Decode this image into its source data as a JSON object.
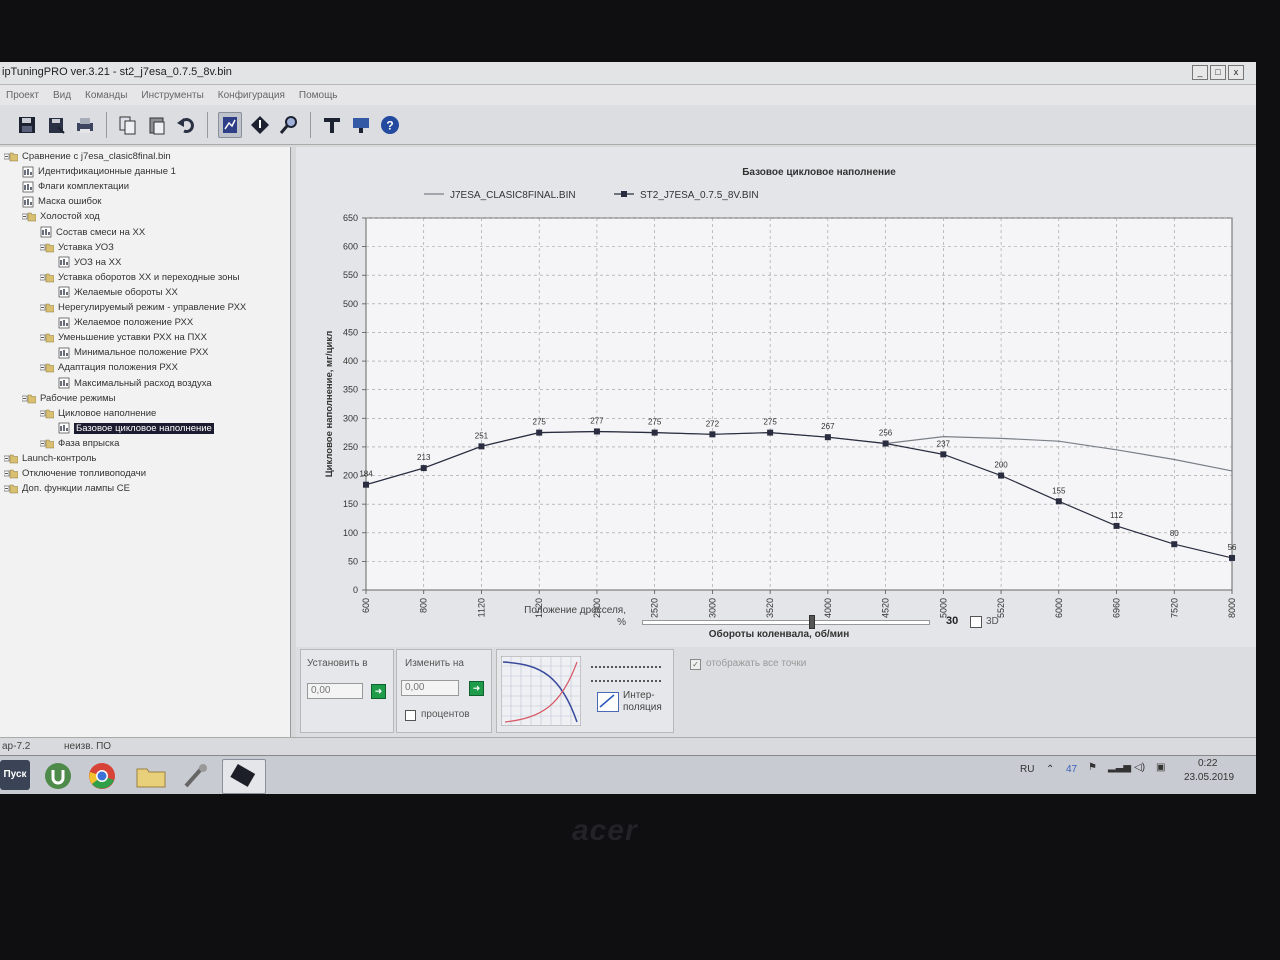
{
  "window": {
    "title": "ipTuningPRO ver.3.21 - st2_j7esa_0.7.5_8v.bin",
    "controls": [
      "_",
      "□",
      "x"
    ]
  },
  "menu": [
    "Проект",
    "Вид",
    "Команды",
    "Инструменты",
    "Конфигурация",
    "Помощь"
  ],
  "tree": [
    {
      "label": "Сравнение с j7esa_clasic8final.bin",
      "level": 0,
      "kind": "root"
    },
    {
      "label": "Идентификационные данные 1",
      "level": 1,
      "kind": "leaf"
    },
    {
      "label": "Флаги комплектации",
      "level": 1,
      "kind": "leaf"
    },
    {
      "label": "Маска ошибок",
      "level": 1,
      "kind": "leaf"
    },
    {
      "label": "Холостой ход",
      "level": 1,
      "kind": "folder"
    },
    {
      "label": "Состав смеси на ХХ",
      "level": 2,
      "kind": "leaf"
    },
    {
      "label": "Уставка УОЗ",
      "level": 2,
      "kind": "folder"
    },
    {
      "label": "УОЗ на ХХ",
      "level": 3,
      "kind": "leaf"
    },
    {
      "label": "Уставка оборотов ХХ и переходные зоны",
      "level": 2,
      "kind": "folder"
    },
    {
      "label": "Желаемые обороты ХХ",
      "level": 3,
      "kind": "leaf"
    },
    {
      "label": "Нерегулируемый режим - управление РХХ",
      "level": 2,
      "kind": "folder"
    },
    {
      "label": "Желаемое положение РХХ",
      "level": 3,
      "kind": "leaf"
    },
    {
      "label": "Уменьшение уставки РХХ на ПХХ",
      "level": 2,
      "kind": "folder"
    },
    {
      "label": "Минимальное положение РХХ",
      "level": 3,
      "kind": "leaf"
    },
    {
      "label": "Адаптация положения РХХ",
      "level": 2,
      "kind": "folder"
    },
    {
      "label": "Максимальный расход воздуха",
      "level": 3,
      "kind": "leaf"
    },
    {
      "label": "Рабочие режимы",
      "level": 1,
      "kind": "folder"
    },
    {
      "label": "Цикловое наполнение",
      "level": 2,
      "kind": "folder"
    },
    {
      "label": "Базовое цикловое наполнение",
      "level": 3,
      "kind": "leaf",
      "selected": true
    },
    {
      "label": "Фаза впрыска",
      "level": 2,
      "kind": "folder"
    },
    {
      "label": "Launch-контроль",
      "level": 0,
      "kind": "folder"
    },
    {
      "label": "Отключение топливоподачи",
      "level": 0,
      "kind": "folder"
    },
    {
      "label": "Доп. функции лампы CE",
      "level": 0,
      "kind": "folder"
    }
  ],
  "chart_data": {
    "type": "line",
    "title": "Базовое цикловое наполнение",
    "xlabel": "Обороты коленвала, об/мин",
    "ylabel": "Цикловое наполнение, мг/цикл",
    "categories": [
      "600",
      "800",
      "1120",
      "1520",
      "2000",
      "2520",
      "3000",
      "3520",
      "4000",
      "4520",
      "5000",
      "5520",
      "6000",
      "6960",
      "7520",
      "8000"
    ],
    "yticks": [
      0,
      50,
      100,
      150,
      200,
      250,
      300,
      350,
      400,
      450,
      500,
      550,
      600,
      650
    ],
    "ylim": [
      0,
      650
    ],
    "grid": true,
    "legend": "top-left",
    "series": [
      {
        "name": "J7ESA_CLASIC8FINAL.BIN",
        "values": [
          184,
          213,
          251,
          275,
          277,
          275,
          272,
          275,
          267,
          256,
          268,
          265,
          260,
          245,
          228,
          208
        ],
        "marker": false,
        "labels": false,
        "color": "#7a7f86"
      },
      {
        "name": "ST2_J7ESA_0.7.5_8V.BIN",
        "values": [
          184,
          213,
          251,
          275,
          277,
          275,
          272,
          275,
          267,
          256,
          237,
          200,
          155,
          112,
          80,
          56
        ],
        "marker": true,
        "labels": true,
        "color": "#2a2d40"
      }
    ]
  },
  "throttle": {
    "label_line1": "Положение дросселя,",
    "label_line2": "%",
    "value_text": "30",
    "value": 30,
    "option_3d": "3D",
    "option_3d_checked": false
  },
  "controls": {
    "set_label": "Установить в",
    "set_value": "0,00",
    "change_label": "Изменить на",
    "change_value": "0,00",
    "percent_label": "процентов",
    "interp_line1": "Интер-",
    "interp_line2": "поляция",
    "show_points_label": "отображать все точки",
    "show_points_checked": true
  },
  "statusbar": {
    "left": "ар-7.2",
    "mid": "неизв. ПО"
  },
  "taskbar": {
    "start": "Пуск",
    "lang": "RU",
    "battery": "47",
    "time": "0:22",
    "date": "23.05.2019"
  },
  "bezel": {
    "brand": "acer"
  }
}
